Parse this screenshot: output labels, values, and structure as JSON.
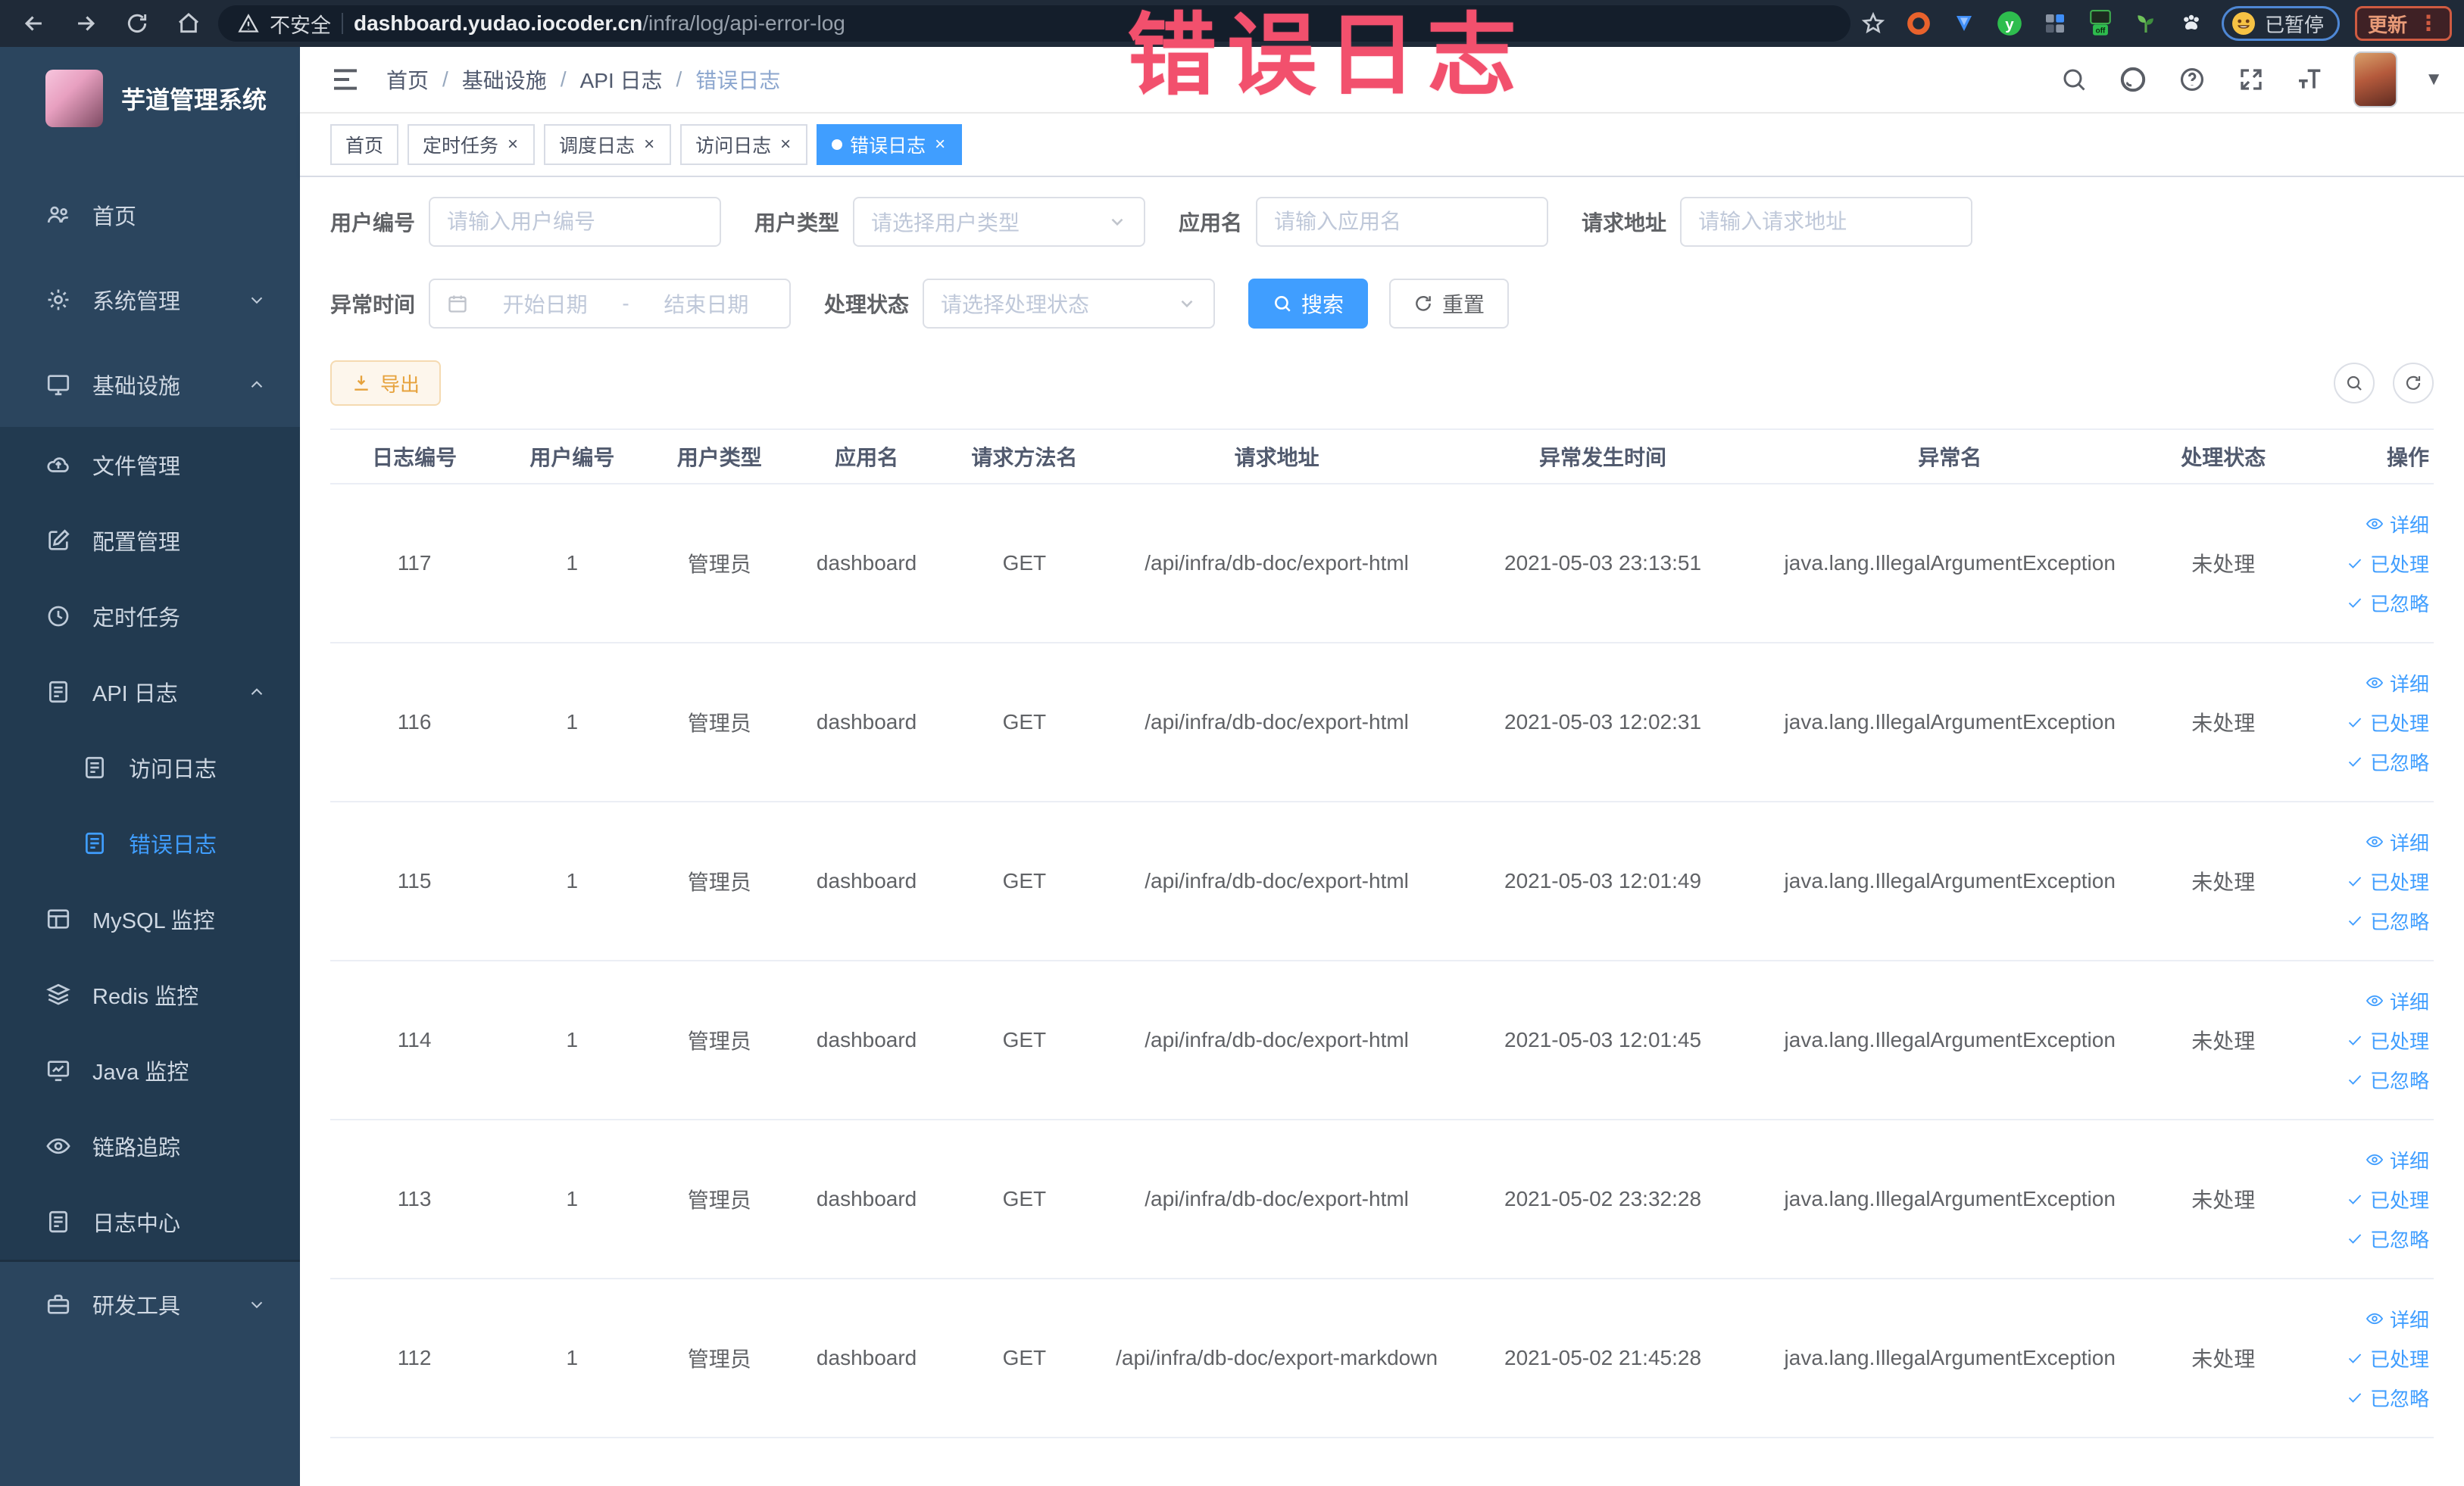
{
  "browser": {
    "security_label": "不安全",
    "url_domain": "dashboard.yudao.iocoder.cn",
    "url_path": "/infra/log/api-error-log",
    "paused_label": "已暂停",
    "update_label": "更新"
  },
  "annotation": {
    "text": "错误日志",
    "color": "#f2506d"
  },
  "sidebar": {
    "title": "芋道管理系统",
    "items": [
      {
        "icon": "people",
        "label": "首页",
        "level": 1,
        "sub": false,
        "chevron": "",
        "active": false
      },
      {
        "icon": "gear",
        "label": "系统管理",
        "level": 1,
        "sub": false,
        "chevron": "down",
        "active": false
      },
      {
        "icon": "monitor",
        "label": "基础设施",
        "level": 1,
        "sub": false,
        "chevron": "up",
        "active": false
      },
      {
        "icon": "cloud",
        "label": "文件管理",
        "level": 2,
        "sub": true,
        "chevron": "",
        "active": false
      },
      {
        "icon": "edit",
        "label": "配置管理",
        "level": 2,
        "sub": true,
        "chevron": "",
        "active": false
      },
      {
        "icon": "clock",
        "label": "定时任务",
        "level": 2,
        "sub": true,
        "chevron": "",
        "active": false
      },
      {
        "icon": "log",
        "label": "API 日志",
        "level": 2,
        "sub": true,
        "chevron": "up",
        "active": false
      },
      {
        "icon": "log",
        "label": "访问日志",
        "level": 3,
        "sub": true,
        "chevron": "",
        "active": false
      },
      {
        "icon": "log",
        "label": "错误日志",
        "level": 3,
        "sub": true,
        "chevron": "",
        "active": true
      },
      {
        "icon": "table",
        "label": "MySQL 监控",
        "level": 2,
        "sub": true,
        "chevron": "",
        "active": false
      },
      {
        "icon": "layers",
        "label": "Redis 监控",
        "level": 2,
        "sub": true,
        "chevron": "",
        "active": false
      },
      {
        "icon": "dash",
        "label": "Java 监控",
        "level": 2,
        "sub": true,
        "chevron": "",
        "active": false
      },
      {
        "icon": "eye",
        "label": "链路追踪",
        "level": 2,
        "sub": true,
        "chevron": "",
        "active": false
      },
      {
        "icon": "log",
        "label": "日志中心",
        "level": 2,
        "sub": true,
        "chevron": "",
        "active": false
      },
      {
        "icon": "case",
        "label": "研发工具",
        "level": 1,
        "sub": false,
        "chevron": "down",
        "active": false
      }
    ]
  },
  "breadcrumb": {
    "items": [
      "首页",
      "基础设施",
      "API 日志",
      "错误日志"
    ],
    "separator": "/"
  },
  "tabs": [
    {
      "label": "首页",
      "closable": false,
      "active": false
    },
    {
      "label": "定时任务",
      "closable": true,
      "active": false
    },
    {
      "label": "调度日志",
      "closable": true,
      "active": false
    },
    {
      "label": "访问日志",
      "closable": true,
      "active": false
    },
    {
      "label": "错误日志",
      "closable": true,
      "active": true
    }
  ],
  "filters": {
    "user_id": {
      "label": "用户编号",
      "placeholder": "请输入用户编号"
    },
    "user_type": {
      "label": "用户类型",
      "placeholder": "请选择用户类型"
    },
    "app_name": {
      "label": "应用名",
      "placeholder": "请输入应用名"
    },
    "request_url": {
      "label": "请求地址",
      "placeholder": "请输入请求地址"
    },
    "exception_time": {
      "label": "异常时间",
      "start_placeholder": "开始日期",
      "separator": "-",
      "end_placeholder": "结束日期"
    },
    "process_status": {
      "label": "处理状态",
      "placeholder": "请选择处理状态"
    },
    "search_label": "搜索",
    "reset_label": "重置"
  },
  "toolbar": {
    "export_label": "导出"
  },
  "table": {
    "columns": [
      "日志编号",
      "用户编号",
      "用户类型",
      "应用名",
      "请求方法名",
      "请求地址",
      "异常发生时间",
      "异常名",
      "处理状态",
      "操作"
    ],
    "actions": [
      "详细",
      "已处理",
      "已忽略"
    ],
    "rows": [
      {
        "id": "117",
        "user_id": "1",
        "user_type": "管理员",
        "app": "dashboard",
        "method": "GET",
        "url": "/api/infra/db-doc/export-html",
        "time": "2021-05-03 23:13:51",
        "exception": "java.lang.IllegalArgumentException",
        "status": "未处理"
      },
      {
        "id": "116",
        "user_id": "1",
        "user_type": "管理员",
        "app": "dashboard",
        "method": "GET",
        "url": "/api/infra/db-doc/export-html",
        "time": "2021-05-03 12:02:31",
        "exception": "java.lang.IllegalArgumentException",
        "status": "未处理"
      },
      {
        "id": "115",
        "user_id": "1",
        "user_type": "管理员",
        "app": "dashboard",
        "method": "GET",
        "url": "/api/infra/db-doc/export-html",
        "time": "2021-05-03 12:01:49",
        "exception": "java.lang.IllegalArgumentException",
        "status": "未处理"
      },
      {
        "id": "114",
        "user_id": "1",
        "user_type": "管理员",
        "app": "dashboard",
        "method": "GET",
        "url": "/api/infra/db-doc/export-html",
        "time": "2021-05-03 12:01:45",
        "exception": "java.lang.IllegalArgumentException",
        "status": "未处理"
      },
      {
        "id": "113",
        "user_id": "1",
        "user_type": "管理员",
        "app": "dashboard",
        "method": "GET",
        "url": "/api/infra/db-doc/export-html",
        "time": "2021-05-02 23:32:28",
        "exception": "java.lang.IllegalArgumentException",
        "status": "未处理"
      },
      {
        "id": "112",
        "user_id": "1",
        "user_type": "管理员",
        "app": "dashboard",
        "method": "GET",
        "url": "/api/infra/db-doc/export-markdown",
        "time": "2021-05-02 21:45:28",
        "exception": "java.lang.IllegalArgumentException",
        "status": "未处理"
      }
    ]
  },
  "colors": {
    "accent_blue": "#409eff",
    "sidebar_bg": "#2b455e",
    "sidebar_submenu_bg": "#223a50",
    "warning_text": "#e6a23c",
    "annotation_pink": "#f2506d"
  }
}
